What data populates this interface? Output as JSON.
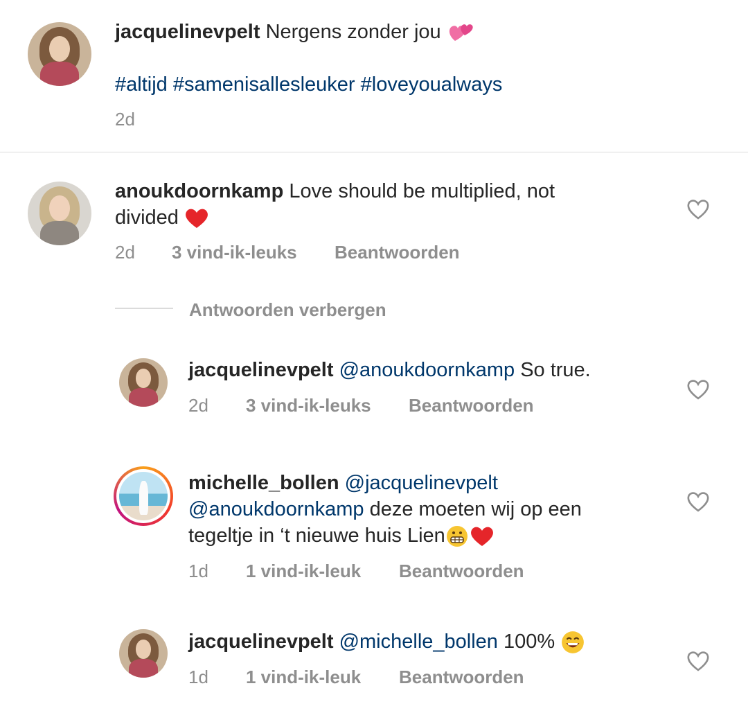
{
  "caption": {
    "username": "jacquelinevpelt",
    "text": "Nergens zonder jou",
    "hashtags": "#altijd #samenisallesleuker #loveyoualways",
    "time": "2d"
  },
  "comments": [
    {
      "username": "anoukdoornkamp",
      "line1": "Love should be multiplied, not",
      "line2": "divided",
      "time": "2d",
      "likes": "3 vind-ik-leuks",
      "reply": "Beantwoorden"
    }
  ],
  "replies_toggle": "Antwoorden verbergen",
  "replies": [
    {
      "username": "jacquelinevpelt",
      "mention": "@anoukdoornkamp",
      "text": "So true.",
      "time": "2d",
      "likes": "3 vind-ik-leuks",
      "reply": "Beantwoorden"
    },
    {
      "username": "michelle_bollen",
      "mention1": "@jacquelinevpelt",
      "mention2": "@anoukdoornkamp",
      "text1": "deze moeten wij op een",
      "text2": "tegeltje in ‘t nieuwe huis Lien",
      "time": "1d",
      "likes": "1 vind-ik-leuk",
      "reply": "Beantwoorden"
    },
    {
      "username": "jacquelinevpelt",
      "mention": "@michelle_bollen",
      "text": "100%",
      "time": "1d",
      "likes": "1 vind-ik-leuk",
      "reply": "Beantwoorden"
    }
  ],
  "icons": {
    "like": "heart-outline-icon",
    "two_hearts": "two-hearts-emoji",
    "red_heart": "red-heart-emoji",
    "grimace": "grimacing-face-emoji",
    "smile": "smiling-face-emoji"
  },
  "colors": {
    "text": "#262626",
    "mention": "#00376b",
    "meta": "#8e8e8e",
    "heart": "#ed4956"
  }
}
